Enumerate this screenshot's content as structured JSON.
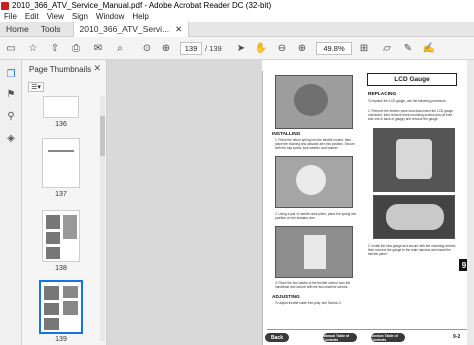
{
  "window": {
    "title": "2010_366_ATV_Service_Manual.pdf - Adobe Acrobat Reader DC (32-bit)"
  },
  "menu": [
    "File",
    "Edit",
    "View",
    "Sign",
    "Window",
    "Help"
  ],
  "tabs": {
    "home": "Home",
    "tools": "Tools",
    "document": "2010_366_ATV_Servi..."
  },
  "toolbar": {
    "page_current": "139",
    "page_total": "/ 139",
    "zoom": "49.8%"
  },
  "thumbnails": {
    "title": "Page Thumbnails",
    "pages": [
      {
        "label": "136"
      },
      {
        "label": "137"
      },
      {
        "label": "138"
      },
      {
        "label": "139"
      }
    ]
  },
  "page": {
    "section_title": "LCD Gauge",
    "replacing_heading": "REPLACING",
    "replacing_intro": "To replace the LCD gauge, use the following procedure.",
    "replacing_step1": "1. Remove the electric panel and disconnect the LCD gauge connector; then remove three mounting screws (two at front and one in back of gauge) and remove the gauge.",
    "replacing_step2": "2. Install the new gauge and secure with the mounting screws; then connect the gauge to the main harness and install the electric panel.",
    "installing_heading": "INSTALLING",
    "installing_step1": "1. Place the return spring into the throttle control; then place the bushing and actuator arm into position. Secure with the cap screw, lock washer, and washer.",
    "installing_step2": "2. Using a pair of needle-nose pliers, place the spring into position on the actuator arm.",
    "installing_step3": "3. Place the two halves of the throttle control onto the handlebar and secure with the two machine screws.",
    "adjusting_heading": "ADJUSTING",
    "adjusting_text": "To adjust throttle cable free-play, see Section 2.",
    "section_tab": "9",
    "nav_back": "Back",
    "nav_manual": "Manual Table of Contents",
    "nav_section": "Section Table of Contents",
    "page_number": "9-2"
  }
}
